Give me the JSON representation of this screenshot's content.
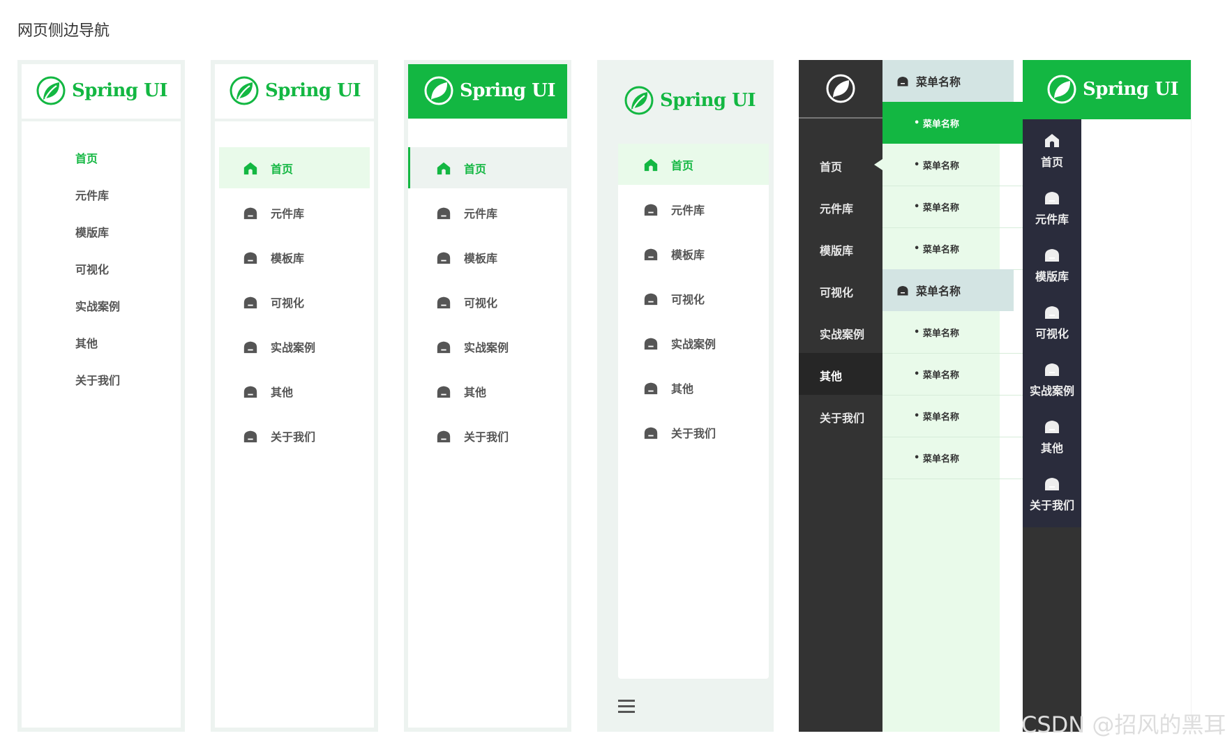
{
  "page_title": "网页侧边导航",
  "brand": {
    "name": "Spring UI",
    "green": "#13b742",
    "dark": "#333333",
    "navy": "#2a2c3c",
    "light_green": "#e9faea",
    "frame": "#edf3f0"
  },
  "menu": [
    "首页",
    "元件库",
    "模板库",
    "可视化",
    "实战案例",
    "其他",
    "关于我们"
  ],
  "menu_alt": [
    "首页",
    "元件库",
    "模版库",
    "可视化",
    "实战案例",
    "其他",
    "关于我们"
  ],
  "submenu": {
    "group1": "菜单名称",
    "group1_items": [
      "菜单名称",
      "菜单名称",
      "菜单名称",
      "菜单名称"
    ],
    "group2": "菜单名称",
    "group2_items": [
      "菜单名称",
      "菜单名称",
      "菜单名称",
      "菜单名称"
    ]
  },
  "icons": {
    "home": "home-icon",
    "item": "dome-icon",
    "menu": "hamburger-icon",
    "logo": "leaf-logo-icon"
  },
  "watermark": "CSDN @招风的黑耳"
}
